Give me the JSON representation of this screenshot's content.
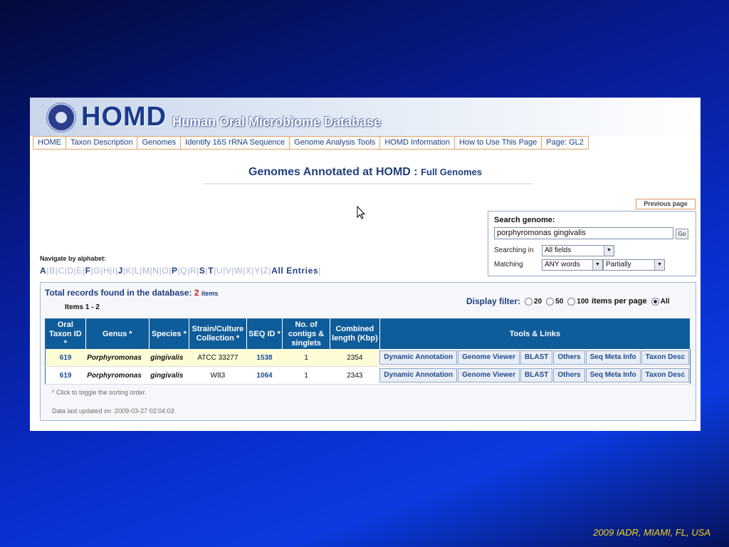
{
  "header": {
    "logo": "HOMD",
    "logo_subtitle": "Human Oral Microbiome Database"
  },
  "nav": [
    {
      "label": "HOME"
    },
    {
      "label": "Taxon Description"
    },
    {
      "label": "Genomes"
    },
    {
      "label": "Identify 16S rRNA Sequence"
    },
    {
      "label": "Genome Analysis Tools"
    },
    {
      "label": "HOMD Information"
    },
    {
      "label": "How to Use This Page"
    },
    {
      "label": "Page: GL2"
    }
  ],
  "page": {
    "title": "Genomes Annotated at HOMD : ",
    "title_sub": "Full Genomes",
    "previous_page": "Previous page"
  },
  "search": {
    "label": "Search genome:",
    "query": "porphyromonas gingivalis",
    "go": "Go",
    "searching_in_label": "Searching in",
    "searching_in_value": "All fields",
    "matching_label": "Matching",
    "matching_value": "ANY words",
    "partial_value": "Partially"
  },
  "alphabet": {
    "label": "Navigate by alphabet:",
    "letters": [
      {
        "t": "A",
        "active": true
      },
      {
        "t": "B",
        "active": false
      },
      {
        "t": "C",
        "active": false
      },
      {
        "t": "D",
        "active": false
      },
      {
        "t": "E",
        "active": false
      },
      {
        "t": "F",
        "active": true
      },
      {
        "t": "G",
        "active": false
      },
      {
        "t": "H",
        "active": false
      },
      {
        "t": "I",
        "active": false
      },
      {
        "t": "J",
        "active": true
      },
      {
        "t": "K",
        "active": false
      },
      {
        "t": "L",
        "active": false
      },
      {
        "t": "M",
        "active": false
      },
      {
        "t": "N",
        "active": false
      },
      {
        "t": "O",
        "active": false
      },
      {
        "t": "P",
        "active": true
      },
      {
        "t": "Q",
        "active": false
      },
      {
        "t": "R",
        "active": false
      },
      {
        "t": "S",
        "active": true
      },
      {
        "t": "T",
        "active": true
      },
      {
        "t": "U",
        "active": false
      },
      {
        "t": "V",
        "active": false
      },
      {
        "t": "W",
        "active": false
      },
      {
        "t": "X",
        "active": false
      },
      {
        "t": "Y",
        "active": false
      },
      {
        "t": "Z",
        "active": false
      }
    ],
    "all_entries": "All Entries"
  },
  "results": {
    "total_label": "Total records found in the database: ",
    "total_count": "2",
    "total_unit": "items",
    "items_range": "Items 1 - 2",
    "filter_label": "Display filter:",
    "filter_options": [
      {
        "label": "20",
        "selected": false
      },
      {
        "label": "50",
        "selected": false
      },
      {
        "label": "100",
        "selected": false
      }
    ],
    "per_page": "items per page",
    "all_label": "All",
    "all_selected": true
  },
  "table": {
    "headers": {
      "taxon": "Oral Taxon ID *",
      "genus": "Genus *",
      "species": "Species *",
      "strain": "Strain/Culture Collection *",
      "seq": "SEQ ID *",
      "contigs": "No. of contigs & singlets",
      "length": "Combined length (Kbp)",
      "tools": "Tools & Links"
    },
    "rows": [
      {
        "taxon": "619",
        "genus": "Porphyromonas",
        "species": "gingivalis",
        "strain": "ATCC 33277",
        "seq": "1538",
        "contigs": "1",
        "length": "2354"
      },
      {
        "taxon": "619",
        "genus": "Porphyromonas",
        "species": "gingivalis",
        "strain": "W83",
        "seq": "1064",
        "contigs": "1",
        "length": "2343"
      }
    ],
    "tools": [
      "Dynamic Annotation",
      "Genome Viewer",
      "BLAST",
      "Others",
      "Seq Meta Info",
      "Taxon Desc"
    ]
  },
  "footer": {
    "sort_note": "* Click to toggle the sorting order.",
    "updated": "Data last updated on :2009-03-27 02:04:03"
  },
  "slide_caption": "2009 IADR, MIAMI, FL, USA"
}
